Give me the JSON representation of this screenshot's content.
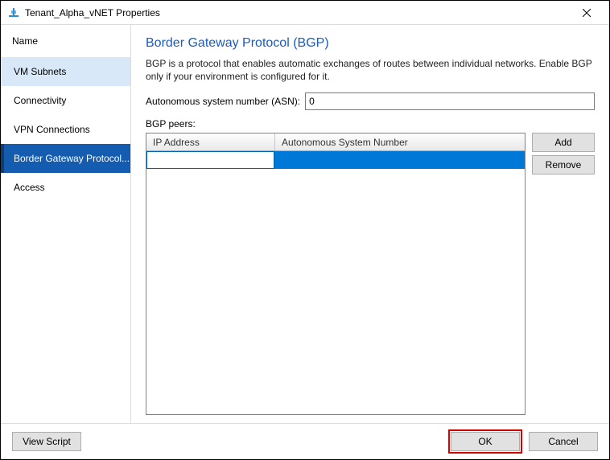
{
  "window": {
    "title": "Tenant_Alpha_vNET Properties"
  },
  "sidebar": {
    "header": "Name",
    "items": [
      {
        "label": "VM Subnets",
        "state": "highlight"
      },
      {
        "label": "Connectivity",
        "state": "normal"
      },
      {
        "label": "VPN Connections",
        "state": "normal"
      },
      {
        "label": "Border Gateway Protocol...",
        "state": "selected"
      },
      {
        "label": "Access",
        "state": "normal"
      }
    ]
  },
  "page": {
    "title": "Border Gateway Protocol (BGP)",
    "description": "BGP is a protocol that enables automatic exchanges of routes between individual networks. Enable BGP only if your environment is configured for it.",
    "asn_label": "Autonomous system number (ASN):",
    "asn_value": "0",
    "peers_label": "BGP peers:",
    "table": {
      "col_ip": "IP Address",
      "col_asn": "Autonomous System Number",
      "rows": [
        {
          "ip": "",
          "asn": ""
        }
      ]
    },
    "buttons": {
      "add": "Add",
      "remove": "Remove"
    }
  },
  "footer": {
    "view_script": "View Script",
    "ok": "OK",
    "cancel": "Cancel"
  }
}
